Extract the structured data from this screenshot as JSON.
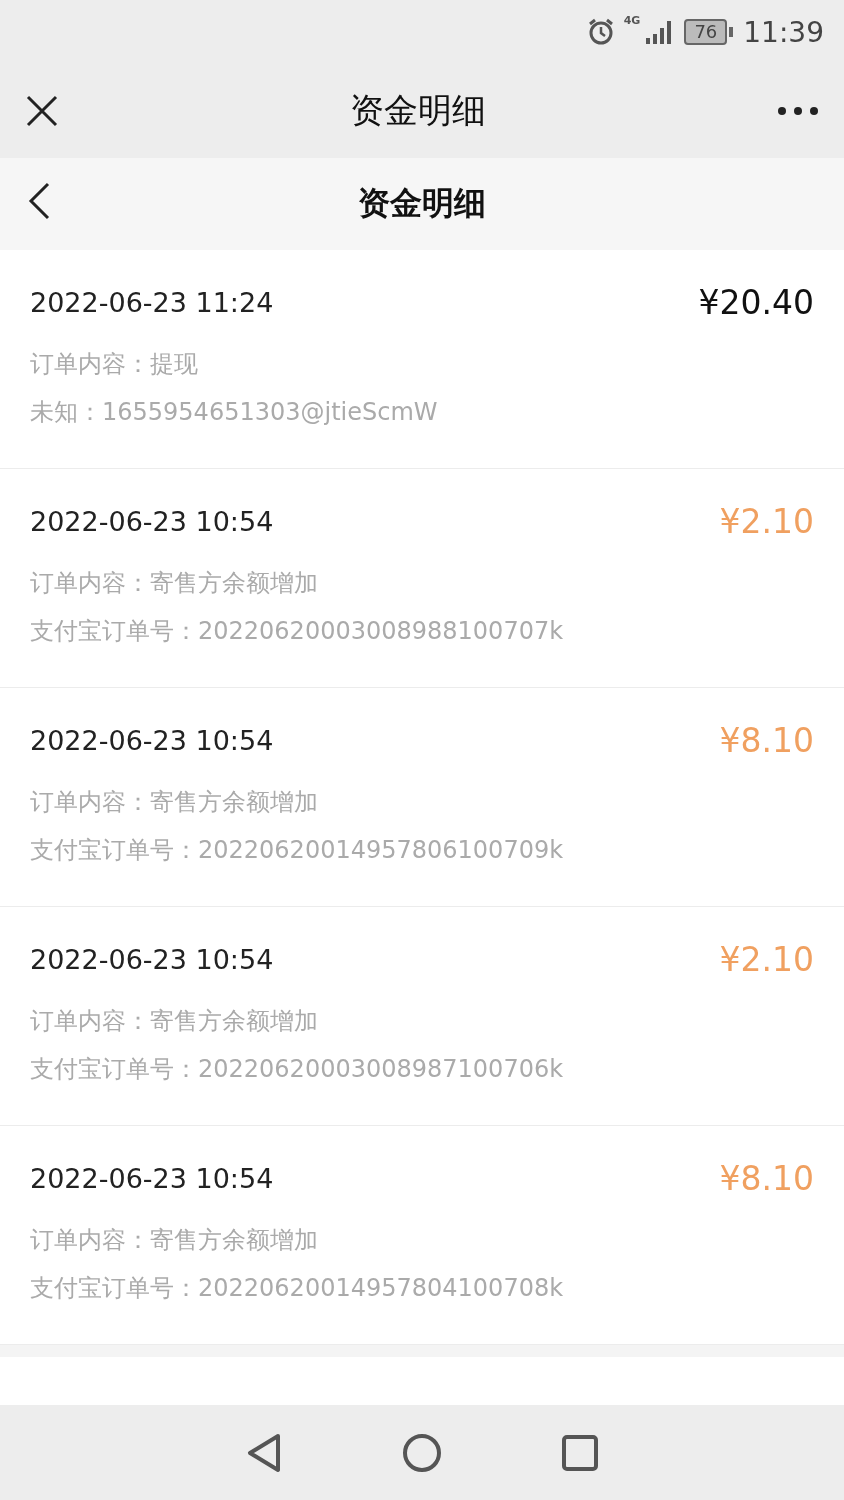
{
  "status_bar": {
    "battery": "76",
    "time": "11:39",
    "network": "4G"
  },
  "window": {
    "title": "资金明细"
  },
  "page_header": {
    "title": "资金明细"
  },
  "records": [
    {
      "datetime": "2022-06-23 11:24",
      "amount": "¥20.40",
      "color": "#111111",
      "lines": [
        "订单内容：提现",
        "未知：1655954651303@jtieScmW"
      ]
    },
    {
      "datetime": "2022-06-23 10:54",
      "amount": "¥2.10",
      "color": "#f0a060",
      "lines": [
        "订单内容：寄售方余额增加",
        "支付宝订单号：20220620003008988100707k"
      ]
    },
    {
      "datetime": "2022-06-23 10:54",
      "amount": "¥8.10",
      "color": "#f0a060",
      "lines": [
        "订单内容：寄售方余额增加",
        "支付宝订单号：20220620014957806100709k"
      ]
    },
    {
      "datetime": "2022-06-23 10:54",
      "amount": "¥2.10",
      "color": "#f0a060",
      "lines": [
        "订单内容：寄售方余额增加",
        "支付宝订单号：20220620003008987100706k"
      ]
    },
    {
      "datetime": "2022-06-23 10:54",
      "amount": "¥8.10",
      "color": "#f0a060",
      "lines": [
        "订单内容：寄售方余额增加",
        "支付宝订单号：20220620014957804100708k"
      ]
    }
  ]
}
